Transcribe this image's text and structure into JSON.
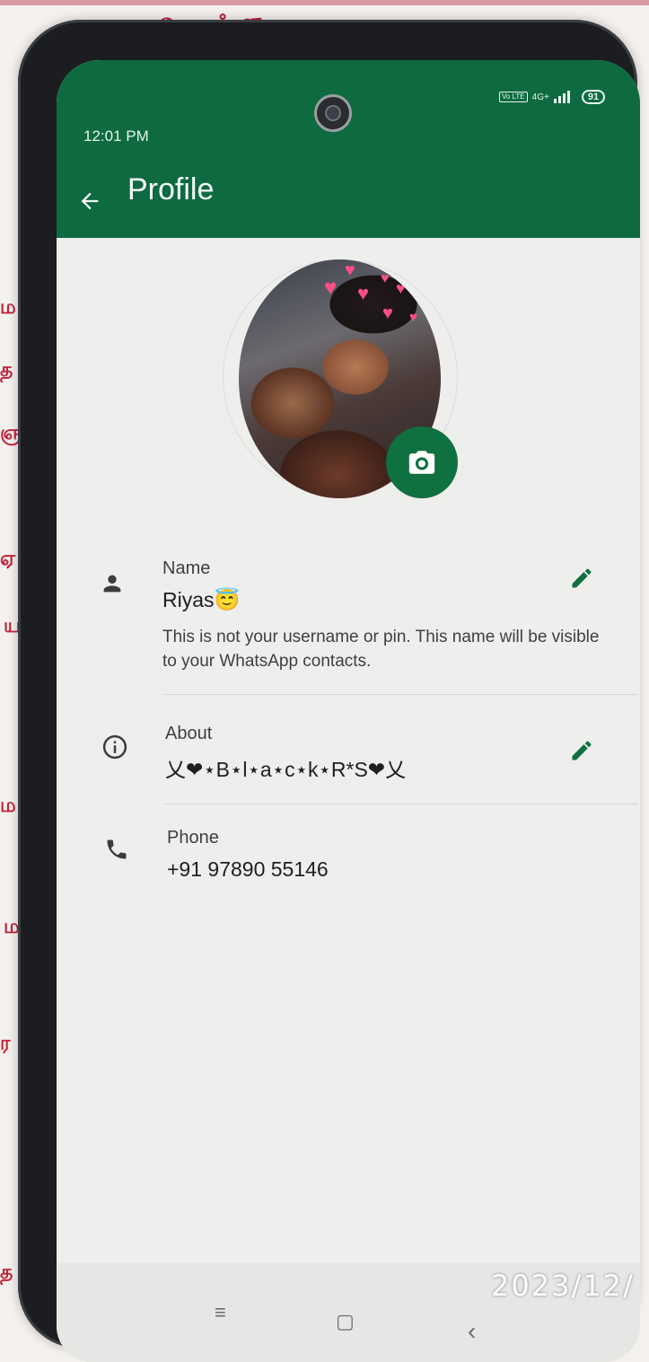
{
  "status_bar": {
    "time": "12:01 PM",
    "volte_label": "Vo LTE",
    "network": "4G+",
    "battery": "91"
  },
  "appbar": {
    "title": "Profile",
    "back_icon": "arrow-left-icon",
    "color": "#0d6b3f"
  },
  "profile_photo": {
    "camera_icon": "camera-icon",
    "accent": "#0f7040"
  },
  "fields": {
    "name": {
      "label": "Name",
      "value": "Riyas😇",
      "hint": "This is not your username or pin. This name will be visible to your WhatsApp contacts.",
      "icon": "person-icon",
      "edit_icon": "pencil-icon"
    },
    "about": {
      "label": "About",
      "value": "乂❤⋆B⋆l⋆a⋆c⋆k⋆R*S❤乂",
      "icon": "info-icon",
      "edit_icon": "pencil-icon"
    },
    "phone": {
      "label": "Phone",
      "value": "+91 97890 55146",
      "icon": "phone-icon"
    }
  },
  "nav_bar": {
    "menu": "≡",
    "home": "▢",
    "back": "‹"
  },
  "photo_timestamp": "2023/12/"
}
